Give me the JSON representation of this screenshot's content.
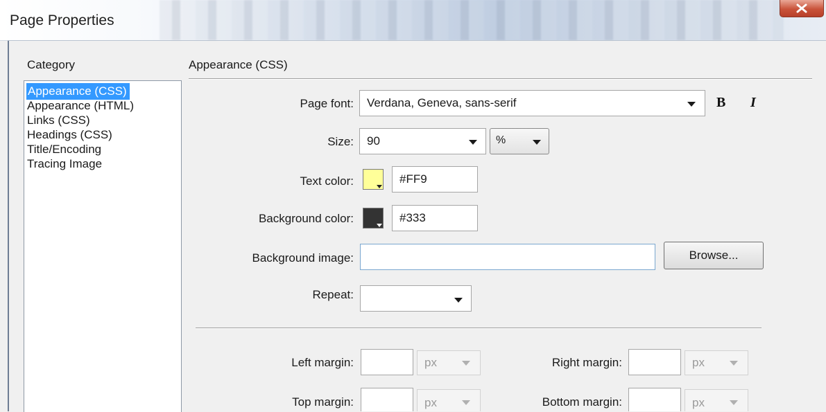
{
  "window": {
    "title": "Page Properties"
  },
  "category": {
    "heading": "Category",
    "items": [
      "Appearance (CSS)",
      "Appearance (HTML)",
      "Links (CSS)",
      "Headings (CSS)",
      "Title/Encoding",
      "Tracing Image"
    ],
    "selected_index": 0
  },
  "panel": {
    "heading": "Appearance (CSS)",
    "page_font": {
      "label": "Page font:",
      "value": "Verdana, Geneva, sans-serif",
      "bold_glyph": "B",
      "italic_glyph": "I"
    },
    "size": {
      "label": "Size:",
      "value": "90",
      "unit": "%"
    },
    "text_color": {
      "label": "Text color:",
      "value": "#FF9",
      "swatch": "#ffff99"
    },
    "background_color": {
      "label": "Background color:",
      "value": "#333",
      "swatch": "#333333"
    },
    "background_image": {
      "label": "Background image:",
      "value": "",
      "browse_label": "Browse..."
    },
    "repeat": {
      "label": "Repeat:",
      "value": ""
    },
    "margins": {
      "left_label": "Left margin:",
      "right_label": "Right margin:",
      "top_label": "Top margin:",
      "bottom_label": "Bottom margin:",
      "unit": "px"
    }
  }
}
